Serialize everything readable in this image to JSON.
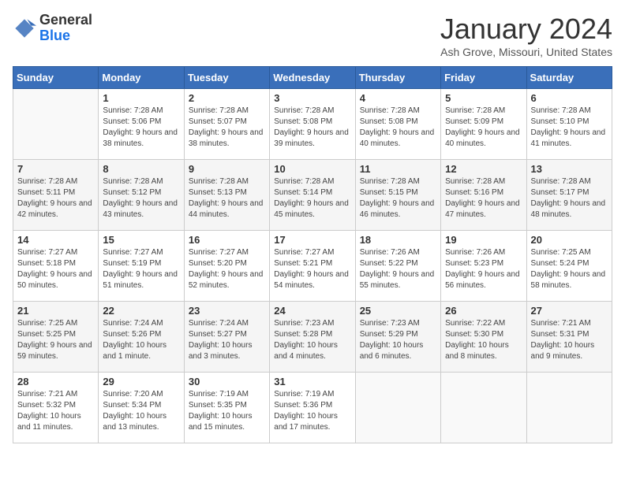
{
  "logo": {
    "general": "General",
    "blue": "Blue"
  },
  "header": {
    "title": "January 2024",
    "location": "Ash Grove, Missouri, United States"
  },
  "weekdays": [
    "Sunday",
    "Monday",
    "Tuesday",
    "Wednesday",
    "Thursday",
    "Friday",
    "Saturday"
  ],
  "weeks": [
    [
      {
        "day": "",
        "sunrise": "",
        "sunset": "",
        "daylight": ""
      },
      {
        "day": "1",
        "sunrise": "Sunrise: 7:28 AM",
        "sunset": "Sunset: 5:06 PM",
        "daylight": "Daylight: 9 hours and 38 minutes."
      },
      {
        "day": "2",
        "sunrise": "Sunrise: 7:28 AM",
        "sunset": "Sunset: 5:07 PM",
        "daylight": "Daylight: 9 hours and 38 minutes."
      },
      {
        "day": "3",
        "sunrise": "Sunrise: 7:28 AM",
        "sunset": "Sunset: 5:08 PM",
        "daylight": "Daylight: 9 hours and 39 minutes."
      },
      {
        "day": "4",
        "sunrise": "Sunrise: 7:28 AM",
        "sunset": "Sunset: 5:08 PM",
        "daylight": "Daylight: 9 hours and 40 minutes."
      },
      {
        "day": "5",
        "sunrise": "Sunrise: 7:28 AM",
        "sunset": "Sunset: 5:09 PM",
        "daylight": "Daylight: 9 hours and 40 minutes."
      },
      {
        "day": "6",
        "sunrise": "Sunrise: 7:28 AM",
        "sunset": "Sunset: 5:10 PM",
        "daylight": "Daylight: 9 hours and 41 minutes."
      }
    ],
    [
      {
        "day": "7",
        "sunrise": "Sunrise: 7:28 AM",
        "sunset": "Sunset: 5:11 PM",
        "daylight": "Daylight: 9 hours and 42 minutes."
      },
      {
        "day": "8",
        "sunrise": "Sunrise: 7:28 AM",
        "sunset": "Sunset: 5:12 PM",
        "daylight": "Daylight: 9 hours and 43 minutes."
      },
      {
        "day": "9",
        "sunrise": "Sunrise: 7:28 AM",
        "sunset": "Sunset: 5:13 PM",
        "daylight": "Daylight: 9 hours and 44 minutes."
      },
      {
        "day": "10",
        "sunrise": "Sunrise: 7:28 AM",
        "sunset": "Sunset: 5:14 PM",
        "daylight": "Daylight: 9 hours and 45 minutes."
      },
      {
        "day": "11",
        "sunrise": "Sunrise: 7:28 AM",
        "sunset": "Sunset: 5:15 PM",
        "daylight": "Daylight: 9 hours and 46 minutes."
      },
      {
        "day": "12",
        "sunrise": "Sunrise: 7:28 AM",
        "sunset": "Sunset: 5:16 PM",
        "daylight": "Daylight: 9 hours and 47 minutes."
      },
      {
        "day": "13",
        "sunrise": "Sunrise: 7:28 AM",
        "sunset": "Sunset: 5:17 PM",
        "daylight": "Daylight: 9 hours and 48 minutes."
      }
    ],
    [
      {
        "day": "14",
        "sunrise": "Sunrise: 7:27 AM",
        "sunset": "Sunset: 5:18 PM",
        "daylight": "Daylight: 9 hours and 50 minutes."
      },
      {
        "day": "15",
        "sunrise": "Sunrise: 7:27 AM",
        "sunset": "Sunset: 5:19 PM",
        "daylight": "Daylight: 9 hours and 51 minutes."
      },
      {
        "day": "16",
        "sunrise": "Sunrise: 7:27 AM",
        "sunset": "Sunset: 5:20 PM",
        "daylight": "Daylight: 9 hours and 52 minutes."
      },
      {
        "day": "17",
        "sunrise": "Sunrise: 7:27 AM",
        "sunset": "Sunset: 5:21 PM",
        "daylight": "Daylight: 9 hours and 54 minutes."
      },
      {
        "day": "18",
        "sunrise": "Sunrise: 7:26 AM",
        "sunset": "Sunset: 5:22 PM",
        "daylight": "Daylight: 9 hours and 55 minutes."
      },
      {
        "day": "19",
        "sunrise": "Sunrise: 7:26 AM",
        "sunset": "Sunset: 5:23 PM",
        "daylight": "Daylight: 9 hours and 56 minutes."
      },
      {
        "day": "20",
        "sunrise": "Sunrise: 7:25 AM",
        "sunset": "Sunset: 5:24 PM",
        "daylight": "Daylight: 9 hours and 58 minutes."
      }
    ],
    [
      {
        "day": "21",
        "sunrise": "Sunrise: 7:25 AM",
        "sunset": "Sunset: 5:25 PM",
        "daylight": "Daylight: 9 hours and 59 minutes."
      },
      {
        "day": "22",
        "sunrise": "Sunrise: 7:24 AM",
        "sunset": "Sunset: 5:26 PM",
        "daylight": "Daylight: 10 hours and 1 minute."
      },
      {
        "day": "23",
        "sunrise": "Sunrise: 7:24 AM",
        "sunset": "Sunset: 5:27 PM",
        "daylight": "Daylight: 10 hours and 3 minutes."
      },
      {
        "day": "24",
        "sunrise": "Sunrise: 7:23 AM",
        "sunset": "Sunset: 5:28 PM",
        "daylight": "Daylight: 10 hours and 4 minutes."
      },
      {
        "day": "25",
        "sunrise": "Sunrise: 7:23 AM",
        "sunset": "Sunset: 5:29 PM",
        "daylight": "Daylight: 10 hours and 6 minutes."
      },
      {
        "day": "26",
        "sunrise": "Sunrise: 7:22 AM",
        "sunset": "Sunset: 5:30 PM",
        "daylight": "Daylight: 10 hours and 8 minutes."
      },
      {
        "day": "27",
        "sunrise": "Sunrise: 7:21 AM",
        "sunset": "Sunset: 5:31 PM",
        "daylight": "Daylight: 10 hours and 9 minutes."
      }
    ],
    [
      {
        "day": "28",
        "sunrise": "Sunrise: 7:21 AM",
        "sunset": "Sunset: 5:32 PM",
        "daylight": "Daylight: 10 hours and 11 minutes."
      },
      {
        "day": "29",
        "sunrise": "Sunrise: 7:20 AM",
        "sunset": "Sunset: 5:34 PM",
        "daylight": "Daylight: 10 hours and 13 minutes."
      },
      {
        "day": "30",
        "sunrise": "Sunrise: 7:19 AM",
        "sunset": "Sunset: 5:35 PM",
        "daylight": "Daylight: 10 hours and 15 minutes."
      },
      {
        "day": "31",
        "sunrise": "Sunrise: 7:19 AM",
        "sunset": "Sunset: 5:36 PM",
        "daylight": "Daylight: 10 hours and 17 minutes."
      },
      {
        "day": "",
        "sunrise": "",
        "sunset": "",
        "daylight": ""
      },
      {
        "day": "",
        "sunrise": "",
        "sunset": "",
        "daylight": ""
      },
      {
        "day": "",
        "sunrise": "",
        "sunset": "",
        "daylight": ""
      }
    ]
  ]
}
